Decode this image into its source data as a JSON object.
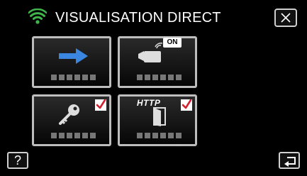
{
  "header": {
    "title": "VISUALISATION DIRECT",
    "wifi_icon": "wifi-icon",
    "wifi_color": "#3fb54a"
  },
  "close_button": {
    "icon": "close-icon"
  },
  "tiles": [
    {
      "id": "direct",
      "icon": "arrow-right-icon",
      "accent": "#3a86e0",
      "label_placeholder": "■■■■■■"
    },
    {
      "id": "camera-on",
      "icon": "video-camera-icon",
      "badge": "ON",
      "label_placeholder": "■■■■■■"
    },
    {
      "id": "key",
      "icon": "key-icon",
      "checked": true,
      "label_placeholder": "■■■■■■"
    },
    {
      "id": "http",
      "icon": "http-door-icon",
      "http_text": "HTTP",
      "checked": true,
      "label_placeholder": "■■■■■■"
    }
  ],
  "check_color": "#d2202f",
  "help_button": {
    "label": "?"
  },
  "back_button": {
    "icon": "return-icon"
  }
}
